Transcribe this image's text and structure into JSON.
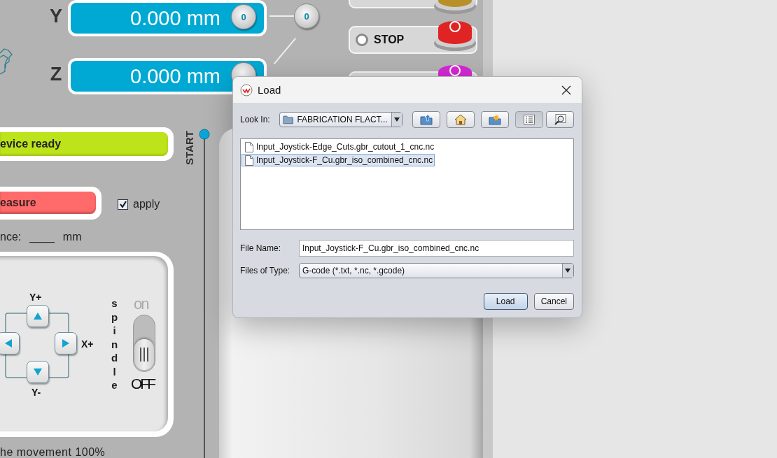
{
  "app": {
    "axes": [
      {
        "label": "Y",
        "value": "0.000 mm",
        "zero": "0"
      },
      {
        "label": "Z",
        "value": "0.000 mm"
      }
    ],
    "zero_all": "0",
    "action_buttons": [
      {
        "kind": "plain",
        "color": "#b8902a"
      },
      {
        "kind": "labeled",
        "label": "STOP",
        "color": "#e02323"
      },
      {
        "kind": "plain",
        "color": "#d42ad4"
      }
    ],
    "status": "evice ready",
    "measure_button": "easure",
    "apply": {
      "label": "apply",
      "checked": true
    },
    "distance": {
      "label": "nce:",
      "value": "____",
      "unit": "mm"
    },
    "jog": {
      "y_plus": "Y+",
      "x_plus": "X+",
      "y_minus": "Y-"
    },
    "spindle": {
      "label": "spindle",
      "on_label": "on",
      "off_label": "OFF",
      "on": false
    },
    "speed_text": "he movement 100%",
    "progress": {
      "label": "START"
    }
  },
  "dialog": {
    "title": "Load",
    "look_in": {
      "label": "Look In:",
      "value": "FABRICATION FLACT..."
    },
    "toolbar": [
      {
        "kind": "up",
        "selected": false
      },
      {
        "kind": "home",
        "selected": false
      },
      {
        "kind": "new_folder",
        "selected": false
      },
      {
        "kind": "list",
        "selected": true
      },
      {
        "kind": "details",
        "selected": false
      }
    ],
    "files": [
      {
        "name": "Input_Joystick-Edge_Cuts.gbr_cutout_1_cnc.nc",
        "selected": false
      },
      {
        "name": "Input_Joystick-F_Cu.gbr_iso_combined_cnc.nc",
        "selected": true
      }
    ],
    "file_name": {
      "label": "File Name:",
      "value": "Input_Joystick-F_Cu.gbr_iso_combined_cnc.nc"
    },
    "files_of_type": {
      "label": "Files of Type:",
      "value": "G-code (*.txt, *.nc, *.gcode)"
    },
    "buttons": [
      {
        "label": "Load",
        "kind": "default"
      },
      {
        "label": "Cancel",
        "kind": "normal"
      }
    ]
  }
}
